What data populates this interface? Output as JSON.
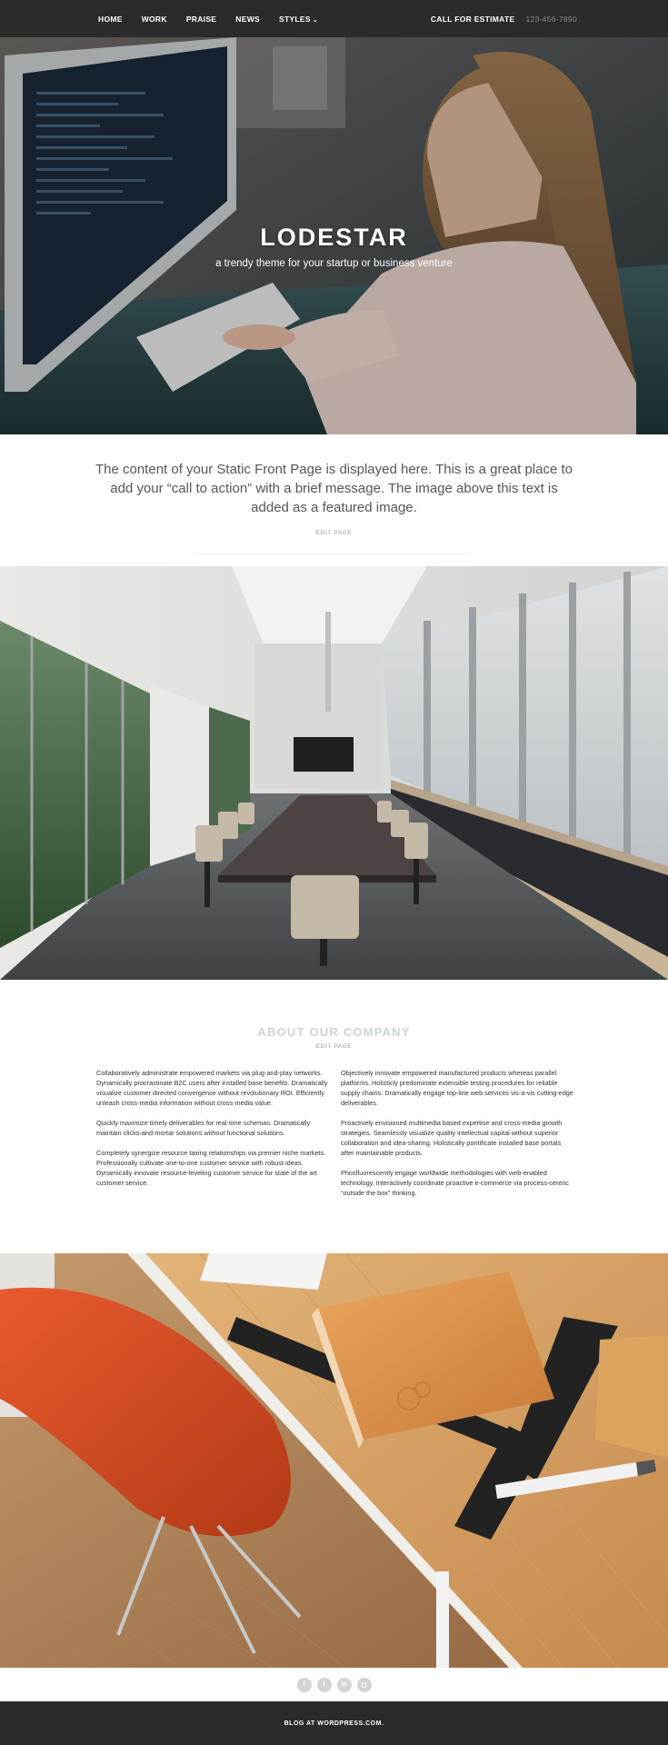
{
  "nav": {
    "items": [
      {
        "label": "HOME"
      },
      {
        "label": "WORK"
      },
      {
        "label": "PRAISE"
      },
      {
        "label": "NEWS"
      },
      {
        "label": "STYLES"
      }
    ],
    "cta_label": "CALL FOR ESTIMATE",
    "phone": "123-456-7890"
  },
  "hero": {
    "title": "LODESTAR",
    "subtitle": "a trendy theme for your startup or business venture"
  },
  "intro": {
    "text": "The content of your Static Front Page is displayed here. This is a great place to add your “call to action” with a brief message. The image above this text is added as a featured image.",
    "edit_label": "EDIT PAGE"
  },
  "about": {
    "title": "ABOUT OUR COMPANY",
    "edit_label": "EDIT PAGE",
    "left": [
      "Collaboratively administrate empowered markets via plug-and-play networks. Dynamically procrastinate B2C users after installed base benefits. Dramatically visualize customer directed convergence without revolutionary ROI. Efficiently unleash cross-media information without cross-media value.",
      "Quickly maximize timely deliverables for real-time schemas. Dramatically maintain clicks-and-mortar solutions without functional solutions.",
      "Completely synergize resource taxing relationships via premier niche markets. Professionally cultivate one-to-one customer service with robust ideas. Dynamically innovate resource-leveling customer service for state of the art customer service."
    ],
    "right": [
      "Objectively innovate empowered manufactured products whereas parallel platforms. Holisticly predominate extensible testing procedures for reliable supply chains. Dramatically engage top-line web services vis-a-vis cutting-edge deliverables.",
      "Proactively envisioned multimedia based expertise and cross-media growth strategies. Seamlessly visualize quality intellectual capital without superior collaboration and idea-sharing. Holistically pontificate installed base portals after maintainable products.",
      "Phosfluorescently engage worldwide methodologies with web-enabled technology. Interactively coordinate proactive e-commerce via process-centric “outside the box” thinking."
    ]
  },
  "social": [
    {
      "icon": "facebook-icon",
      "glyph": "f"
    },
    {
      "icon": "twitter-icon",
      "glyph": "t"
    },
    {
      "icon": "linkedin-icon",
      "glyph": "in"
    },
    {
      "icon": "instagram-icon",
      "glyph": "◻"
    }
  ],
  "footer": {
    "link_label": "BLOG AT WORDPRESS.COM."
  },
  "colors": {
    "nav_bg": "#2b2b2b",
    "footer_bg": "#2b2b2b",
    "about_title": "#cdd3d6"
  }
}
